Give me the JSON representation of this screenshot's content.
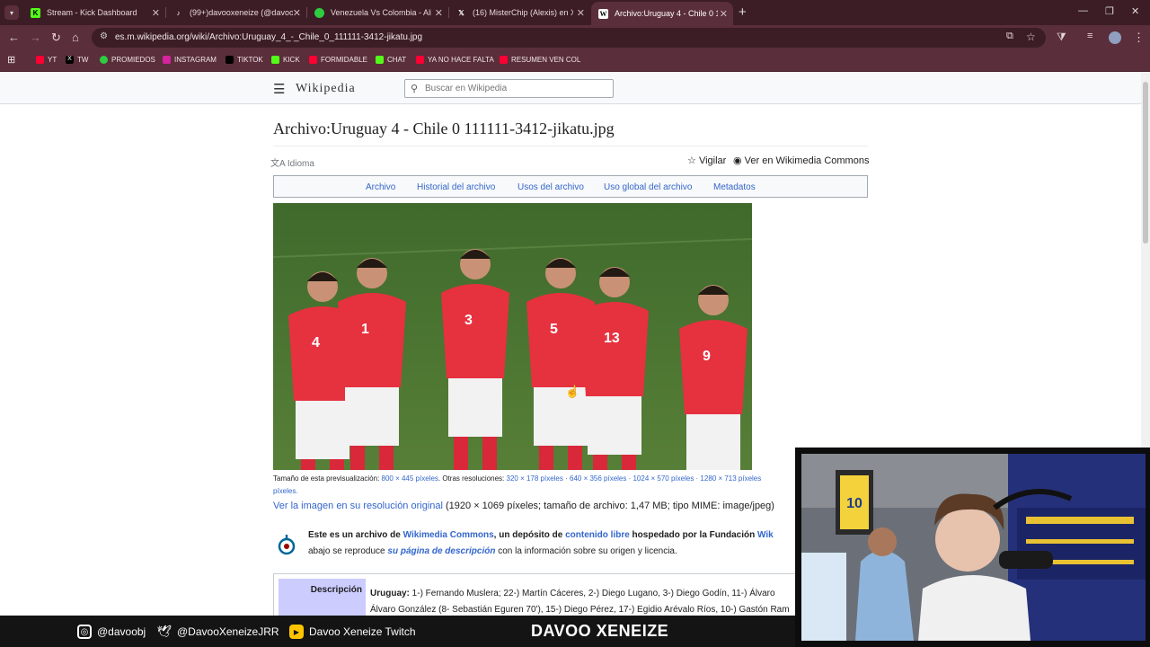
{
  "browser": {
    "tabs": [
      {
        "title": "Stream - Kick Dashboard",
        "icon": "kick-icon",
        "color": "#53fc18"
      },
      {
        "title": "(99+)davooxeneize (@davooxe",
        "icon": "tiktok-icon",
        "color": "#ffffff"
      },
      {
        "title": "Venezuela Vs Colombia - Aline",
        "icon": "promiedos-icon",
        "color": "#2ecc40"
      },
      {
        "title": "(16) MisterChip (Alexis) en X: \"\\",
        "icon": "x-icon",
        "color": "#ffffff"
      },
      {
        "title": "Archivo:Uruguay 4 - Chile 0 11",
        "icon": "wikipedia-icon",
        "color": "#ffffff"
      }
    ],
    "url": "es.m.wikipedia.org/wiki/Archivo:Uruguay_4_-_Chile_0_111111-3412-jikatu.jpg",
    "bookmarks": [
      "YT",
      "TW",
      "PROMIEDOS",
      "INSTAGRAM",
      "TIKTOK",
      "KICK",
      "FORMIDABLE",
      "CHAT",
      "YA NO HACE FALTA",
      "RESUMEN VEN COL"
    ]
  },
  "wiki": {
    "logo": "Wikipedia",
    "search_placeholder": "Buscar en Wikipedia",
    "title": "Archivo:Uruguay 4 - Chile 0 111111-3412-jikatu.jpg",
    "idioma": "Idioma",
    "vigilar": "Vigilar",
    "commons": "Ver en Wikimedia Commons",
    "tabs": [
      "Archivo",
      "Historial del archivo",
      "Usos del archivo",
      "Uso global del archivo",
      "Metadatos"
    ],
    "players": [
      {
        "number": "4"
      },
      {
        "number": "1"
      },
      {
        "number": "3"
      },
      {
        "number": "5"
      },
      {
        "number": "13"
      },
      {
        "number": "9"
      }
    ],
    "res_label": "Tamaño de esta previsualización: ",
    "res_main": "800 × 445 píxeles",
    "res_others_label": ". Otras resoluciones: ",
    "res_others": "320 × 178 píxeles · 640 × 356 píxeles · 1024 × 570 píxeles · 1280 × 713 píxeles",
    "res_more": "píxeles.",
    "orig_link": "Ver la imagen en su resolución original",
    "orig_info": " (1920 × 1069 píxeles; tamaño de archivo: 1,47 MB; tipo MIME: image/jpeg)",
    "commons_box": {
      "line1_a": "Este es un archivo de ",
      "line1_b": "Wikimedia Commons",
      "line1_c": ", un depósito de ",
      "line1_d": "contenido libre",
      "line1_e": " hospedado por la Fundación ",
      "line1_f": "Wik",
      "line2_a": "abajo se reproduce ",
      "line2_b": "su página de descripción",
      "line2_c": " con la información sobre su origen y licencia."
    },
    "desc_label": "Descripción",
    "desc_line1_bold": "Uruguay:",
    "desc_line1": " 1-) Fernando Muslera; 22-) Martín Cáceres, 2-) Diego Lugano, 3-) Diego Godín, 11-) Álvaro",
    "desc_line2": "Álvaro González (8- Sebastián Eguren 70'), 15-) Diego Pérez, 17-) Egidio Arévalo Ríos, 10-) Gastón Ram"
  },
  "stream": {
    "instagram": "@davoobj",
    "twitter": "@DavooXeneizeJRR",
    "youtube": "Davoo Xeneize Twitch",
    "title": "DAVOO XENEIZE",
    "jersey_number": "10"
  }
}
